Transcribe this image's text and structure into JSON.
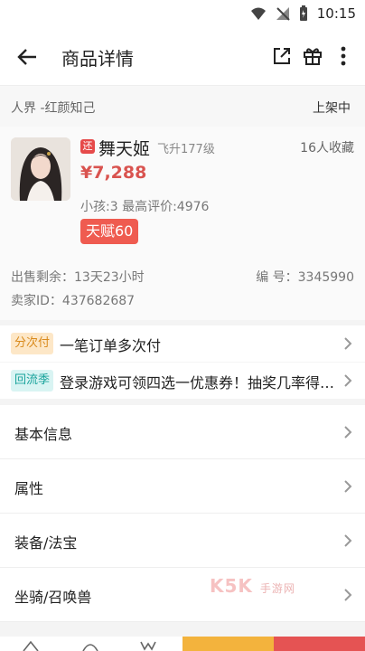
{
  "status_bar": {
    "time": "10:15"
  },
  "app_bar": {
    "title": "商品详情"
  },
  "top_band": {
    "server": "人界 -红颜知己",
    "status": "上架中"
  },
  "product": {
    "tag": "还",
    "name": "舞天姬",
    "level": "飞升177级",
    "favorites": "16人收藏",
    "price": "¥7,288",
    "meta": "小孩:3 最高评价:4976",
    "talent": "天赋60"
  },
  "details": {
    "remaining": "出售剩余：13天23小时",
    "number": "编 号：3345990",
    "seller": "卖家ID：437682687"
  },
  "promos": [
    {
      "pill": "分次付",
      "text": "一笔订单多次付"
    },
    {
      "pill": "回流季",
      "text": "登录游戏可领四选一优惠券！抽奖几率得鎏金…"
    }
  ],
  "sections": [
    {
      "label": "基本信息"
    },
    {
      "label": "属性"
    },
    {
      "label": "装备/法宝"
    },
    {
      "label": "坐骑/召唤兽"
    }
  ],
  "watermark": {
    "brand": "K5K",
    "sub": "手游网"
  },
  "colors": {
    "price": "#d9534f",
    "talent_bg": "#ef5b50",
    "buy_yellow": "#f3b33d",
    "buy_red": "#e55353"
  }
}
